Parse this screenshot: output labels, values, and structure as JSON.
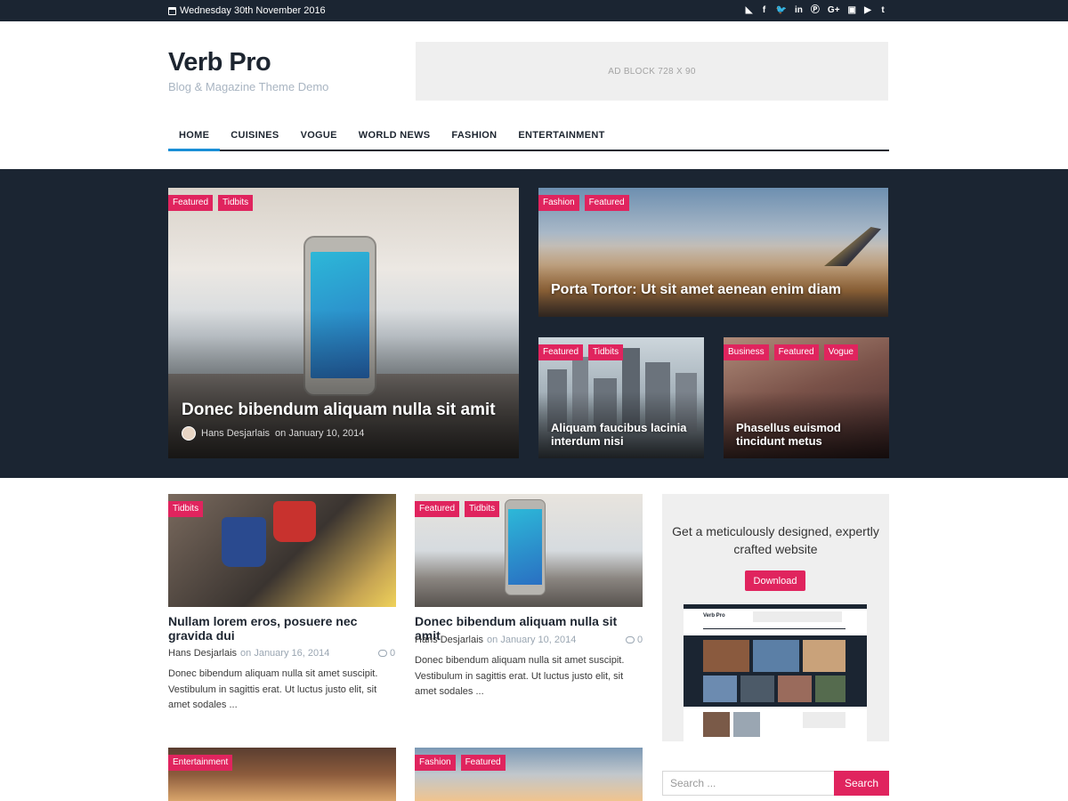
{
  "topbar": {
    "date": "Wednesday 30th November 2016",
    "socials": [
      "rss-icon",
      "facebook-icon",
      "twitter-icon",
      "linkedin-icon",
      "pinterest-icon",
      "googleplus-icon",
      "instagram-icon",
      "youtube-icon",
      "tumblr-icon"
    ]
  },
  "header": {
    "logo": "Verb Pro",
    "tagline": "Blog & Magazine Theme Demo",
    "ad": "AD BLOCK  728 X 90"
  },
  "nav": {
    "items": [
      "HOME",
      "CUISINES",
      "VOGUE",
      "WORLD NEWS",
      "FASHION",
      "ENTERTAINMENT"
    ],
    "active": "HOME"
  },
  "featured": [
    {
      "tags": [
        "Featured",
        "Tidbits"
      ],
      "title": "Donec bibendum aliquam nulla sit amit",
      "author": "Hans Desjarlais",
      "on": "on January 10, 2014"
    },
    {
      "tags": [
        "Fashion",
        "Featured"
      ],
      "title": "Porta Tortor: Ut sit amet aenean enim diam"
    },
    {
      "tags": [
        "Featured",
        "Tidbits"
      ],
      "title": "Aliquam faucibus lacinia interdum nisi"
    },
    {
      "tags": [
        "Business",
        "Featured",
        "Vogue"
      ],
      "title": "Phasellus euismod tincidunt metus"
    }
  ],
  "posts": [
    {
      "tag": "Tidbits",
      "title": "Nullam lorem eros, posuere nec gravida dui",
      "author": "Hans Desjarlais",
      "date": "on January 16, 2014",
      "comments": "0",
      "excerpt": "Donec bibendum aliquam nulla sit amet suscipit. Vestibulum in sagittis erat. Ut luctus justo elit, sit amet sodales ..."
    },
    {
      "tags": [
        "Featured",
        "Tidbits"
      ],
      "title": "Donec bibendum aliquam nulla sit amit",
      "author": "Hans Desjarlais",
      "date": "on January 10, 2014",
      "comments": "0",
      "excerpt": "Donec bibendum aliquam nulla sit amet suscipit. Vestibulum in sagittis erat. Ut luctus justo elit, sit amet sodales ..."
    },
    {
      "tag": "Entertainment"
    },
    {
      "tags": [
        "Fashion",
        "Featured"
      ]
    }
  ],
  "sidebar": {
    "promo_text": "Get a meticulously designed, expertly crafted website",
    "download_label": "Download",
    "mini_logo": "Verb Pro",
    "search_placeholder": "Search ...",
    "search_button": "Search"
  },
  "colors": {
    "dark": "#1b2532",
    "accent": "#e0245e",
    "nav_active": "#1a8fd6"
  }
}
